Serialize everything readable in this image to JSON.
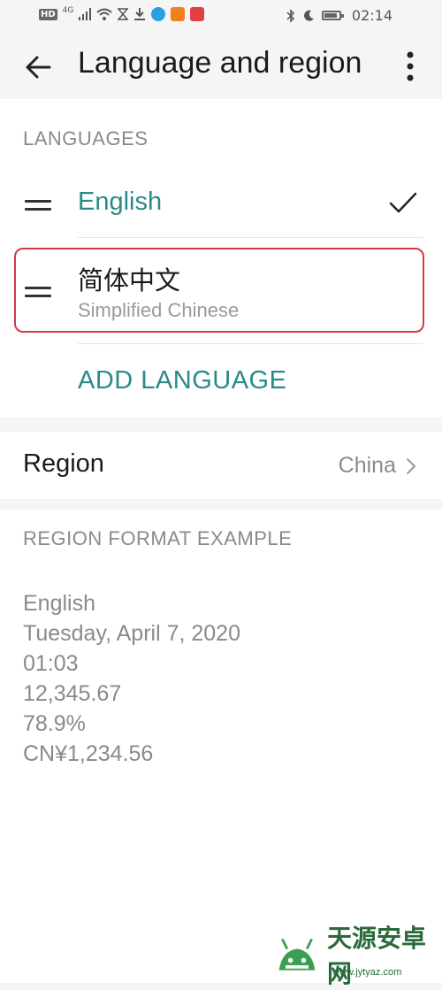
{
  "status_bar": {
    "network_badge": "HD",
    "network_type": "4G",
    "time": "02:14"
  },
  "app_bar": {
    "title": "Language and region"
  },
  "languages_section": {
    "header": "LANGUAGES",
    "items": [
      {
        "label": "English",
        "selected": true
      },
      {
        "label": "简体中文",
        "sublabel": "Simplified Chinese",
        "selected": false
      }
    ],
    "add_label": "ADD LANGUAGE",
    "accent_color": "#2a8a8a",
    "highlight_color": "#d33a45"
  },
  "region": {
    "label": "Region",
    "value": "China"
  },
  "format_example": {
    "header": "REGION FORMAT EXAMPLE",
    "lines": [
      "English",
      "Tuesday, April 7, 2020",
      "01:03",
      "12,345.67",
      "78.9%",
      "CN¥1,234.56"
    ]
  },
  "watermark": {
    "text": "天源安卓网",
    "url": "www.jytyaz.com"
  }
}
